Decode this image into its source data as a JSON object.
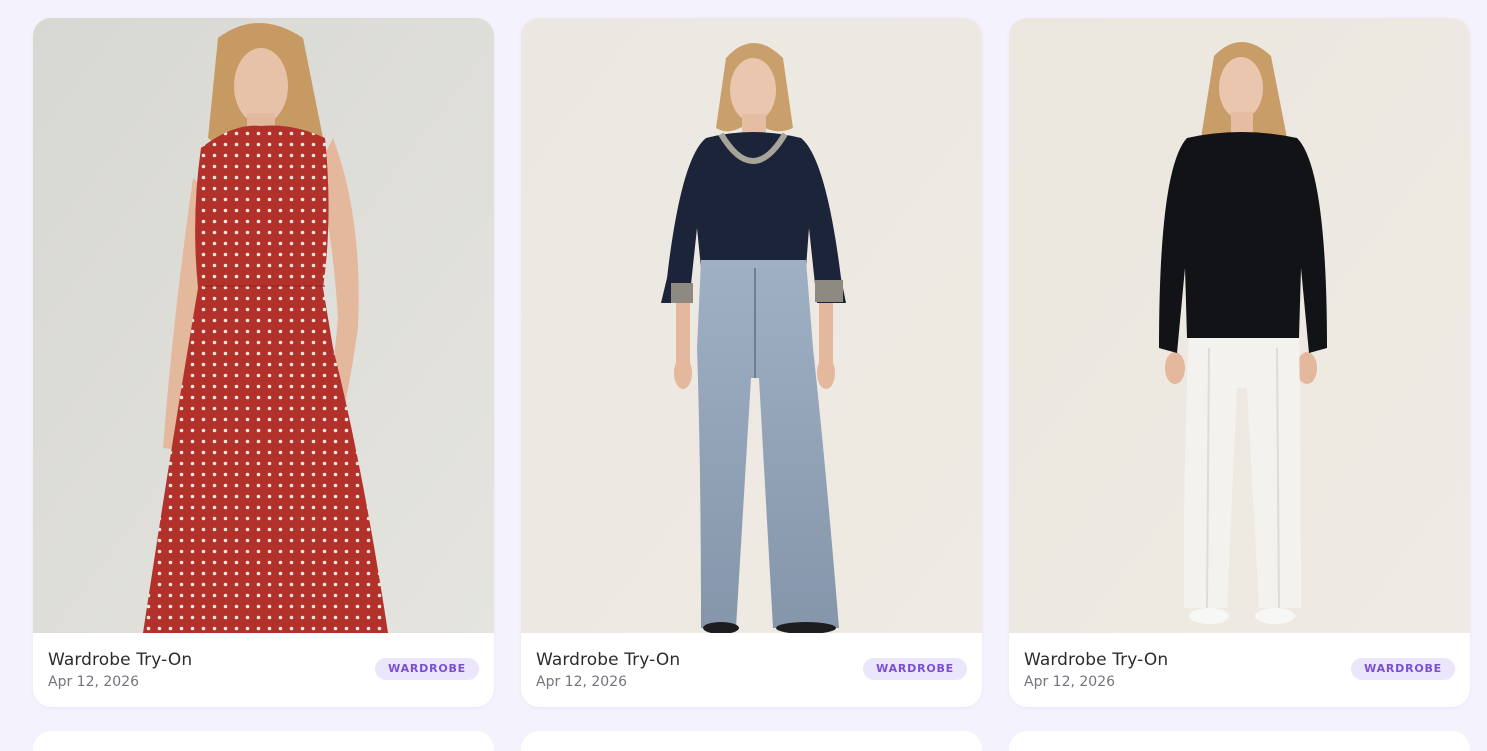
{
  "cards": [
    {
      "title": "Wardrobe Try-On",
      "date": "Apr 12, 2026",
      "badge": "WARDROBE"
    },
    {
      "title": "Wardrobe Try-On",
      "date": "Apr 12, 2026",
      "badge": "WARDROBE"
    },
    {
      "title": "Wardrobe Try-On",
      "date": "Apr 12, 2026",
      "badge": "WARDROBE"
    }
  ],
  "colors": {
    "background": "#f4f3fd",
    "card": "#ffffff",
    "badge_bg": "#ebe6fb",
    "badge_text": "#7a4fd6"
  }
}
